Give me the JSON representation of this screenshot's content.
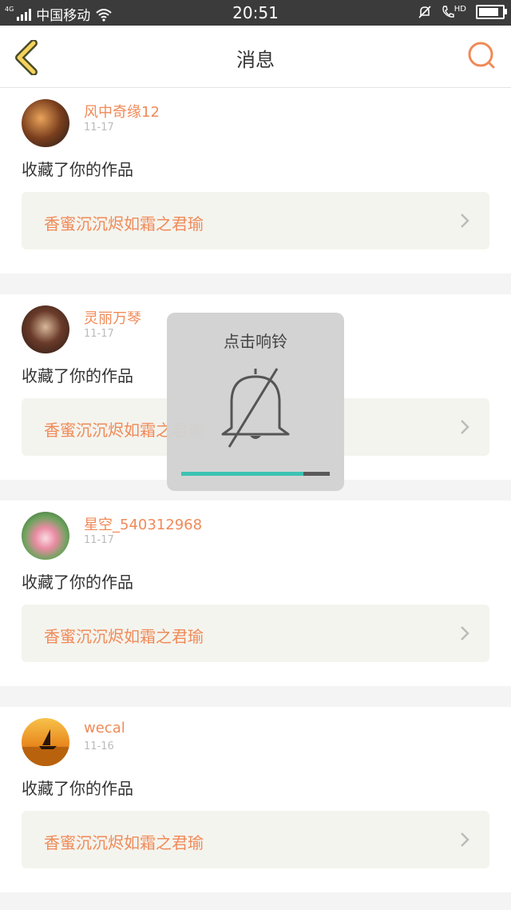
{
  "status_bar": {
    "network": "4G",
    "carrier": "中国移动",
    "time": "20:51",
    "hd_label": "HD"
  },
  "header": {
    "title": "消息"
  },
  "messages": [
    {
      "username": "风中奇缘12",
      "date": "11-17",
      "action": "收藏了你的作品",
      "work_title": "香蜜沉沉烬如霜之君瑜",
      "avatar": "avatar-sunset-figure"
    },
    {
      "username": "灵丽万琴",
      "date": "11-17",
      "action": "收藏了你的作品",
      "work_title": "香蜜沉沉烬如霜之君瑜",
      "avatar": "avatar-portrait-woman"
    },
    {
      "username": "星空_540312968",
      "date": "11-17",
      "action": "收藏了你的作品",
      "work_title": "香蜜沉沉烬如霜之君瑜",
      "avatar": "avatar-lotus-flower"
    },
    {
      "username": "wecal",
      "date": "11-16",
      "action": "收藏了你的作品",
      "work_title": "香蜜沉沉烬如霜之君瑜",
      "avatar": "avatar-sailboat-sunset"
    }
  ],
  "toast": {
    "title": "点击响铃",
    "icon": "bell-muted-icon",
    "volume_level": 0.82
  },
  "colors": {
    "accent": "#f08a58",
    "volume": "#3cc3b3",
    "back_chevron": "#f5d35c"
  }
}
